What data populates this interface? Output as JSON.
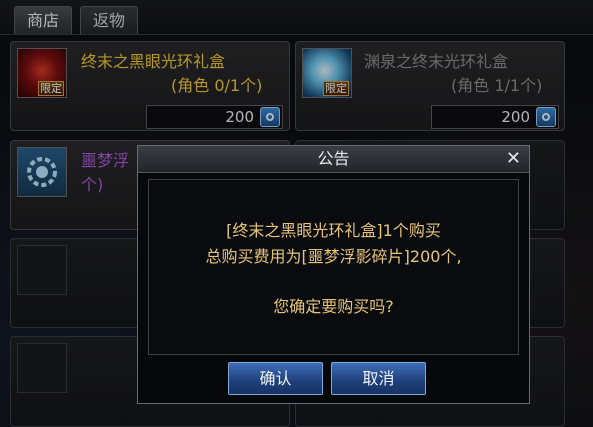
{
  "tabs": [
    {
      "label": "商店"
    },
    {
      "label": "返物"
    }
  ],
  "items": [
    {
      "name": "终末之黑眼光环礼盒",
      "sub": "(角色 0/1个)",
      "badge": "限定",
      "price": "200",
      "name_color": "#f2c83a",
      "sub_color": "#f2c83a"
    },
    {
      "name": "渊泉之终末光环礼盒",
      "sub": "(角色 1/1个)",
      "badge": "限定",
      "price": "200",
      "name_color": "#8d8d8d",
      "sub_color": "#8d8d8d"
    },
    {
      "name": "噩梦浮",
      "sub": "个)",
      "name_color": "#b15be0",
      "sub_color": "#b15be0"
    }
  ],
  "dialog": {
    "title": "公告",
    "line1": "[终末之黑眼光环礼盒]1个购买",
    "line2": "总购买费用为[噩梦浮影碎片]200个,",
    "line3": "您确定要购买吗?",
    "confirm": "确认",
    "cancel": "取消",
    "close_icon": "close-icon",
    "text_color": "#e6c47a"
  }
}
